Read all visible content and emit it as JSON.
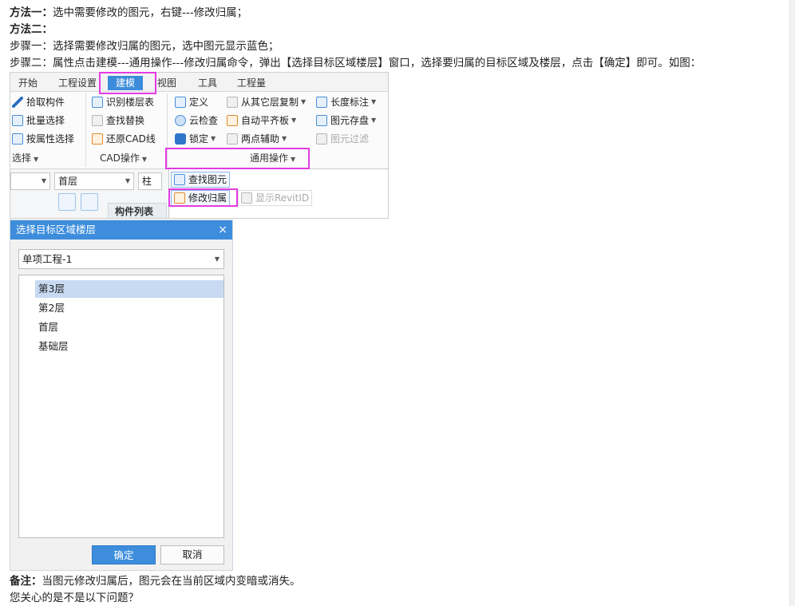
{
  "instructions": {
    "method1_label": "方法一：",
    "method1_text": "选中需要修改的图元，右键---修改归属；",
    "method2_label": "方法二：",
    "step1": "步骤一：选择需要修改归属的图元，选中图元显示蓝色；",
    "step2": "步骤二：属性点击建模---通用操作---修改归属命令，弹出【选择目标区域楼层】窗口，选择要归属的目标区域及楼层，点击【确定】即可。如图："
  },
  "ribbon": {
    "tabs": [
      "开始",
      "工程设置",
      "建模",
      "视图",
      "工具",
      "工程量"
    ],
    "active_tab": "建模",
    "select_group": {
      "items": [
        "拾取构件",
        "批量选择",
        "按属性选择"
      ],
      "label": "选择"
    },
    "cad_group": {
      "items": [
        "识别楼层表",
        "查找替换",
        "还原CAD线"
      ],
      "label": "CAD操作"
    },
    "common_group": {
      "col1": [
        "定义",
        "云检查",
        "锁定"
      ],
      "col2": [
        "从其它层复制",
        "自动平齐板",
        "两点辅助"
      ],
      "col3": [
        "长度标注",
        "图元存盘",
        "图元过滤"
      ],
      "label": "通用操作"
    },
    "lower": {
      "combo_floor": "首层",
      "combo_type": "柱",
      "list_header": "构件列表"
    },
    "dropdown": {
      "items": [
        "查找图元",
        "修改归属",
        "显示RevitID"
      ]
    }
  },
  "dialog": {
    "title": "选择目标区域楼层",
    "close_glyph": "×",
    "region_select": "单项工程-1",
    "floors": [
      "第3层",
      "第2层",
      "首层",
      "基础层"
    ],
    "selected_floor": "第3层",
    "ok_label": "确定",
    "cancel_label": "取消"
  },
  "footer": {
    "note_label": "备注：",
    "note_text": "当图元修改归属后，图元会在当前区域内变暗或消失。",
    "question": "您关心的是不是以下问题？"
  },
  "colors": {
    "accent_blue": "#3d8ddc",
    "highlight_magenta": "#e33be3",
    "selected_row": "#c7daf2"
  }
}
